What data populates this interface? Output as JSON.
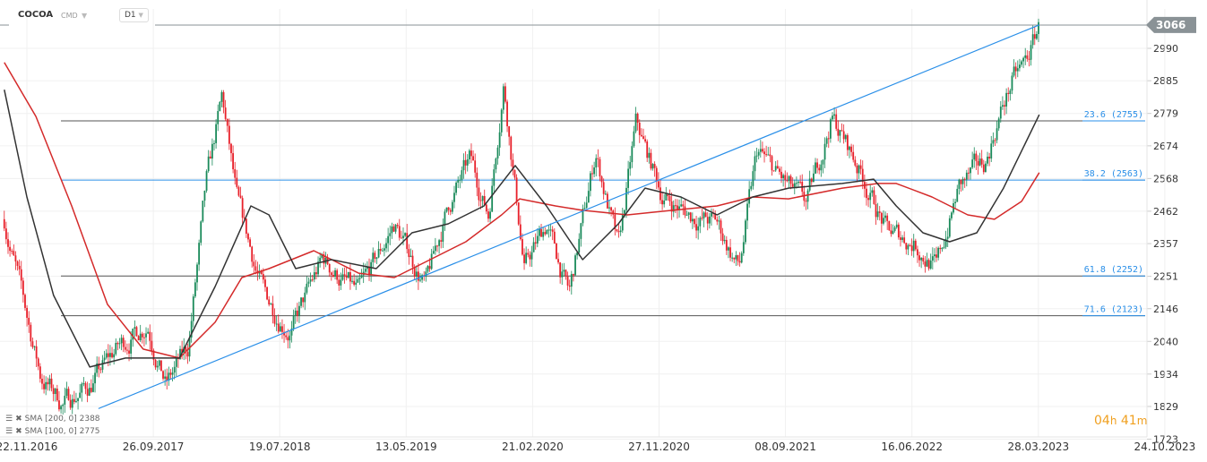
{
  "header": {
    "symbol": "COCOA",
    "type": "CMD",
    "timeframe": "D1"
  },
  "timer": {
    "hours": "04",
    "h": "h",
    "minutes": "41",
    "m": "m"
  },
  "legend": [
    {
      "label": "SMA [200, 0] 2388"
    },
    {
      "label": "SMA [100, 0] 2775"
    }
  ],
  "colors": {
    "up": "#1a8a5a",
    "down": "#e8202a",
    "sma200": "#d42a2a",
    "sma100": "#333333",
    "blue": "#2a8fe8",
    "accent_timer": "#f0a020"
  },
  "chart_data": {
    "type": "candlestick",
    "title": "COCOA",
    "x_unit": "days since 22.11.2016",
    "x_tick_labels": [
      "22.11.2016",
      "26.09.2017",
      "19.07.2018",
      "13.05.2019",
      "21.02.2020",
      "27.11.2020",
      "08.09.2021",
      "16.06.2022",
      "28.03.2023",
      "24.10.2023"
    ],
    "y_ticks": [
      2990,
      2885,
      2779,
      2674,
      2568,
      2462,
      2357,
      2251,
      2146,
      2040,
      1934,
      1829,
      1723
    ],
    "last_price": "3066",
    "last_price_value": 3066,
    "price_path": [
      [
        -55,
        2436
      ],
      [
        -22,
        2247
      ],
      [
        33,
        1928
      ],
      [
        87,
        1840
      ],
      [
        153,
        1898
      ],
      [
        218,
        2015
      ],
      [
        294,
        2102
      ],
      [
        338,
        1898
      ],
      [
        392,
        2015
      ],
      [
        436,
        2537
      ],
      [
        475,
        2827
      ],
      [
        512,
        2479
      ],
      [
        578,
        2189
      ],
      [
        643,
        2073
      ],
      [
        719,
        2305
      ],
      [
        807,
        2189
      ],
      [
        894,
        2421
      ],
      [
        970,
        2218
      ],
      [
        1025,
        2479
      ],
      [
        1079,
        2624
      ],
      [
        1123,
        2450
      ],
      [
        1160,
        2885
      ],
      [
        1210,
        2276
      ],
      [
        1264,
        2421
      ],
      [
        1319,
        2189
      ],
      [
        1384,
        2653
      ],
      [
        1439,
        2334
      ],
      [
        1482,
        2740
      ],
      [
        1548,
        2508
      ],
      [
        1613,
        2450
      ],
      [
        1679,
        2421
      ],
      [
        1733,
        2276
      ],
      [
        1777,
        2653
      ],
      [
        1853,
        2537
      ],
      [
        1897,
        2479
      ],
      [
        1958,
        2769
      ],
      [
        2027,
        2595
      ],
      [
        2093,
        2392
      ],
      [
        2158,
        2363
      ],
      [
        2213,
        2276
      ],
      [
        2267,
        2537
      ],
      [
        2333,
        2624
      ],
      [
        2365,
        2769
      ],
      [
        2398,
        2885
      ],
      [
        2431,
        2943
      ],
      [
        2463,
        3066
      ]
    ],
    "sma100": [
      [
        -55,
        2856
      ],
      [
        0,
        2508
      ],
      [
        65,
        2189
      ],
      [
        153,
        1957
      ],
      [
        240,
        1986
      ],
      [
        371,
        1986
      ],
      [
        458,
        2218
      ],
      [
        545,
        2479
      ],
      [
        589,
        2450
      ],
      [
        654,
        2276
      ],
      [
        741,
        2305
      ],
      [
        850,
        2276
      ],
      [
        937,
        2392
      ],
      [
        1025,
        2421
      ],
      [
        1112,
        2479
      ],
      [
        1188,
        2610
      ],
      [
        1264,
        2479
      ],
      [
        1352,
        2305
      ],
      [
        1439,
        2421
      ],
      [
        1504,
        2537
      ],
      [
        1591,
        2508
      ],
      [
        1679,
        2450
      ],
      [
        1766,
        2508
      ],
      [
        1853,
        2537
      ],
      [
        1984,
        2552
      ],
      [
        2060,
        2566
      ],
      [
        2115,
        2479
      ],
      [
        2180,
        2392
      ],
      [
        2245,
        2363
      ],
      [
        2311,
        2392
      ],
      [
        2376,
        2537
      ],
      [
        2463,
        2775
      ]
    ],
    "sma200": [
      [
        -55,
        2944
      ],
      [
        22,
        2769
      ],
      [
        109,
        2479
      ],
      [
        196,
        2160
      ],
      [
        283,
        2015
      ],
      [
        371,
        1986
      ],
      [
        458,
        2102
      ],
      [
        523,
        2247
      ],
      [
        589,
        2276
      ],
      [
        698,
        2334
      ],
      [
        807,
        2261
      ],
      [
        894,
        2247
      ],
      [
        981,
        2305
      ],
      [
        1068,
        2363
      ],
      [
        1155,
        2450
      ],
      [
        1199,
        2502
      ],
      [
        1286,
        2479
      ],
      [
        1352,
        2465
      ],
      [
        1461,
        2450
      ],
      [
        1570,
        2465
      ],
      [
        1679,
        2479
      ],
      [
        1766,
        2508
      ],
      [
        1853,
        2502
      ],
      [
        1984,
        2537
      ],
      [
        2071,
        2552
      ],
      [
        2115,
        2552
      ],
      [
        2202,
        2508
      ],
      [
        2289,
        2450
      ],
      [
        2354,
        2436
      ],
      [
        2420,
        2494
      ],
      [
        2463,
        2587
      ]
    ],
    "trendline": [
      [
        174,
        1822
      ],
      [
        2463,
        3066
      ]
    ],
    "fibonacci": [
      {
        "label": "23.6 (2755)",
        "price": 2755
      },
      {
        "label": "38.2 (2563)",
        "price": 2563
      },
      {
        "label": "61.8 (2252)",
        "price": 2252
      },
      {
        "label": "71.6 (2123)",
        "price": 2123
      }
    ]
  }
}
